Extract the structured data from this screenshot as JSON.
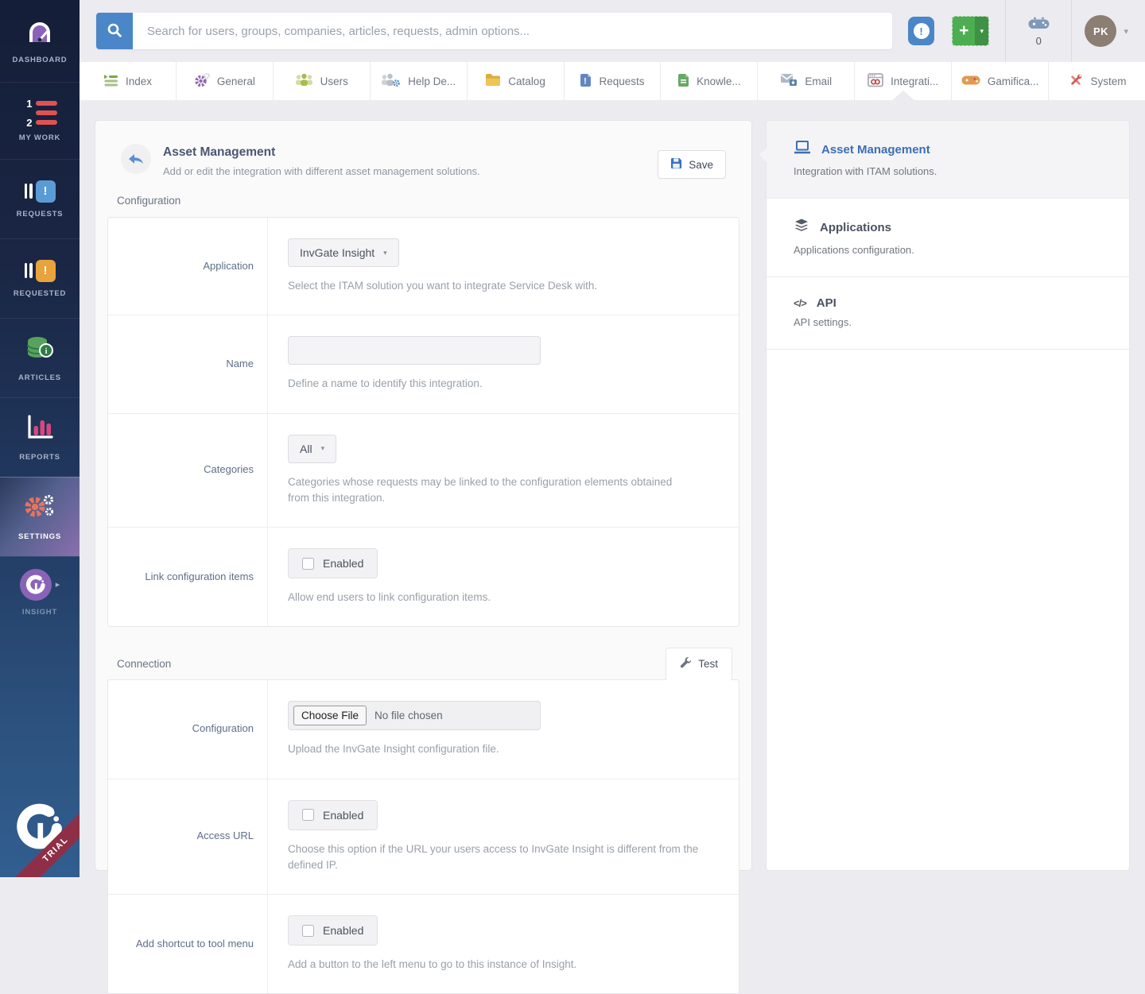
{
  "topbar": {
    "search_placeholder": "Search for users, groups, companies, articles, requests, admin options...",
    "alert_glyph": "!",
    "plus_glyph": "+",
    "caret_glyph": "▾",
    "gamification_count": "0",
    "avatar_initials": "PK"
  },
  "tabs": {
    "active": "Integrati...",
    "items": [
      {
        "label": "Index"
      },
      {
        "label": "General"
      },
      {
        "label": "Users"
      },
      {
        "label": "Help De..."
      },
      {
        "label": "Catalog"
      },
      {
        "label": "Requests"
      },
      {
        "label": "Knowle..."
      },
      {
        "label": "Email"
      },
      {
        "label": "Integrati..."
      },
      {
        "label": "Gamifica..."
      },
      {
        "label": "System"
      }
    ]
  },
  "sidebar": {
    "active_item": "SETTINGS",
    "items": [
      {
        "label": "DASHBOARD"
      },
      {
        "label": "MY WORK"
      },
      {
        "label": "REQUESTS"
      },
      {
        "label": "REQUESTED"
      },
      {
        "label": "ARTICLES"
      },
      {
        "label": "REPORTS"
      },
      {
        "label": "SETTINGS"
      },
      {
        "label": "INSIGHT"
      }
    ],
    "my_work_num1": "1",
    "my_work_num2": "2",
    "requests_glyph": "!",
    "requested_glyph": "!",
    "insight_chevron": "▸",
    "trial_badge": "TRIAL"
  },
  "main": {
    "header": {
      "title": "Asset Management",
      "subtitle": "Add or edit the integration with different asset management solutions.",
      "save_label": "Save"
    },
    "configuration": {
      "section_label": "Configuration",
      "rows": [
        {
          "label": "Application",
          "value": "InvGate Insight",
          "help": "Select the ITAM solution you want to integrate Service Desk with."
        },
        {
          "label": "Name",
          "value": "",
          "help": "Define a name to identify this integration."
        },
        {
          "label": "Categories",
          "value": "All",
          "help": "Categories whose requests may be linked to the configuration elements obtained from this integration."
        },
        {
          "label": "Link configuration items",
          "checkbox_label": "Enabled",
          "help": "Allow end users to link configuration items."
        }
      ]
    },
    "connection": {
      "section_label": "Connection",
      "test_label": "Test",
      "rows": [
        {
          "label": "Configuration",
          "file_button": "Choose File",
          "file_status": "No file chosen",
          "help": "Upload the InvGate Insight configuration file."
        },
        {
          "label": "Access URL",
          "checkbox_label": "Enabled",
          "help": "Choose this option if the URL your users access to InvGate Insight is different from the defined IP."
        },
        {
          "label": "Add shortcut to tool menu",
          "checkbox_label": "Enabled",
          "help": "Add a button to the left menu to go to this instance of Insight."
        }
      ]
    }
  },
  "right_panel": {
    "active_item": "Asset Management",
    "api_glyph": "</>",
    "items": [
      {
        "title": "Asset Management",
        "subtitle": "Integration with ITAM solutions."
      },
      {
        "title": "Applications",
        "subtitle": "Applications configuration."
      },
      {
        "title": "API",
        "subtitle": "API settings."
      }
    ]
  },
  "colors": {
    "accent_blue": "#4A86C8",
    "add_green": "#4CAE50",
    "sidebar_top": "#141E38",
    "sidebar_bottom": "#315E90",
    "settings_highlight": "#8A6FAE",
    "trial_red": "#8E2F47",
    "active_link_blue": "#3C6EB4"
  }
}
